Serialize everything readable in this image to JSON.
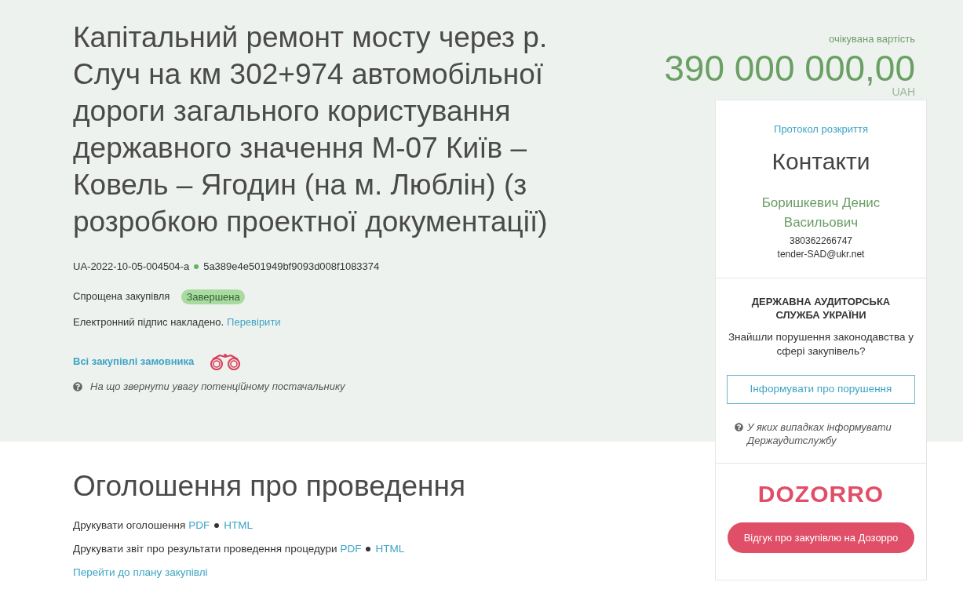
{
  "header": {
    "title": "Капітальний ремонт мосту через р. Случ на км 302+974 автомобільної дороги загального користування державного значення М-07 Київ – Ковель – Ягодин (на м. Люблін) (з розробкою проектної документації)",
    "tender_id": "UA-2022-10-05-004504-a",
    "hash": "5a389e4e501949bf9093d008f1083374",
    "procedure_type": "Спрощена закупівля",
    "status": "Завершена",
    "signature_text": "Електронний підпис накладено.",
    "signature_link": "Перевірити",
    "customer_link": "Всі закупівлі замовника",
    "hint": "На що звернути увагу потенційному постачальнику"
  },
  "budget": {
    "label": "очікувана вартість",
    "amount": "390 000 000,00",
    "currency": "UAH"
  },
  "contacts_card": {
    "protocol_link": "Протокол розкриття",
    "title": "Контакти",
    "name": "Боришкевич Денис Васильович",
    "phone": "380362266747",
    "email": "tender-SAD@ukr.net"
  },
  "audit_card": {
    "title": "ДЕРЖАВНА АУДИТОРСЬКА СЛУЖБА УКРАЇНИ",
    "question": "Знайшли порушення законодавства у сфері закупівель?",
    "button": "Інформувати про порушення",
    "hint": "У яких випадках інформувати Держаудитслужбу"
  },
  "dozorro_card": {
    "logo": "DOZORRO",
    "button": "Відгук про закупівлю на Дозорро"
  },
  "announcement": {
    "title": "Оголошення про проведення",
    "print_rows": [
      {
        "label": "Друкувати оголошення",
        "links": [
          "PDF",
          "HTML"
        ]
      },
      {
        "label": "Друкувати звіт про результати проведення процедури",
        "links": [
          "PDF",
          "HTML"
        ]
      }
    ],
    "plan_link": "Перейти до плану закупівлі"
  }
}
